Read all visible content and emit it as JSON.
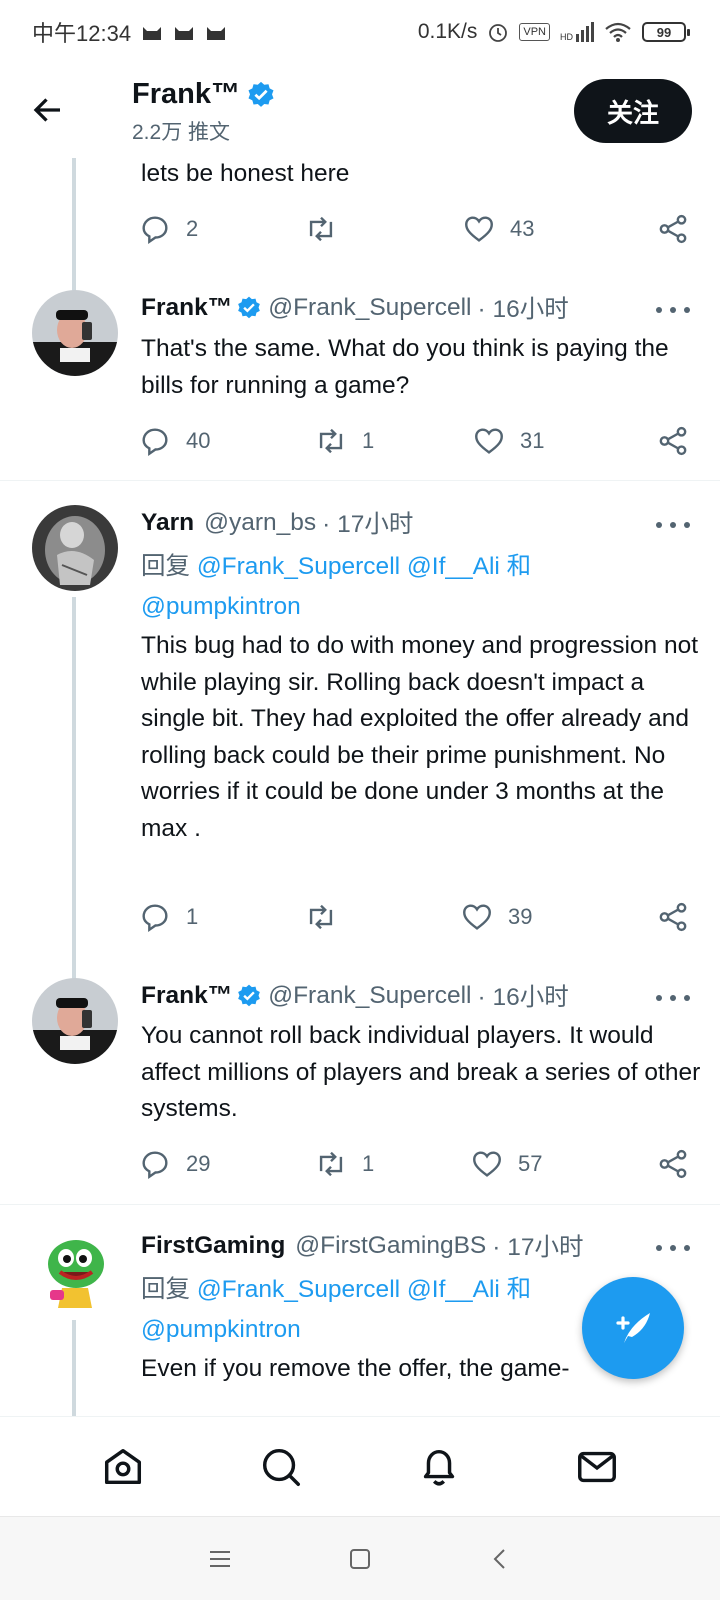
{
  "status_bar": {
    "time": "中午12:34",
    "net_speed": "0.1K/s",
    "vpn": "VPN",
    "hd": "HD",
    "battery": "99"
  },
  "header": {
    "name": "Frank™",
    "tweet_count": "2.2万 推文",
    "follow_label": "关注"
  },
  "tweets": [
    {
      "text": "lets be honest here",
      "replies": "2",
      "retweets": "",
      "likes": "43"
    },
    {
      "name": "Frank™",
      "handle": "@Frank_Supercell",
      "time": "· 16小时",
      "text": "That's the same. What do you think is paying the bills for running a game?",
      "replies": "40",
      "retweets": "1",
      "likes": "31"
    },
    {
      "name": "Yarn",
      "handle": "@yarn_bs",
      "time": "· 17小时",
      "reply_prefix": "回复",
      "mention1": "@Frank_Supercell",
      "mention2": "@If__Ali",
      "and": "和",
      "mention3": "@pumpkintron",
      "text": "This bug had to do with money and progression not while playing sir. Rolling back doesn't impact a single bit. They had exploited the offer already and rolling back could be their prime punishment. No worries if it could be done under 3 months at the max .",
      "replies": "1",
      "retweets": "",
      "likes": "39"
    },
    {
      "name": "Frank™",
      "handle": "@Frank_Supercell",
      "time": "· 16小时",
      "text": "You cannot roll back individual players. It would affect millions of players and break a series of other systems.",
      "replies": "29",
      "retweets": "1",
      "likes": "57"
    },
    {
      "name": "FirstGaming",
      "handle": "@FirstGamingBS",
      "time": "· 17小时",
      "reply_prefix": "回复",
      "mention1": "@Frank_Supercell",
      "mention2": "@If__Ali",
      "and": "和",
      "mention3": "@pumpkintron",
      "text": "Even if you remove the offer, the game-"
    }
  ],
  "icons": {
    "nav": [
      "home-icon",
      "search-icon",
      "notifications-icon",
      "messages-icon"
    ],
    "compose": "compose-tweet-icon"
  },
  "colors": {
    "accent": "#1d9bf0",
    "text": "#0f1419",
    "secondary": "#536471"
  }
}
